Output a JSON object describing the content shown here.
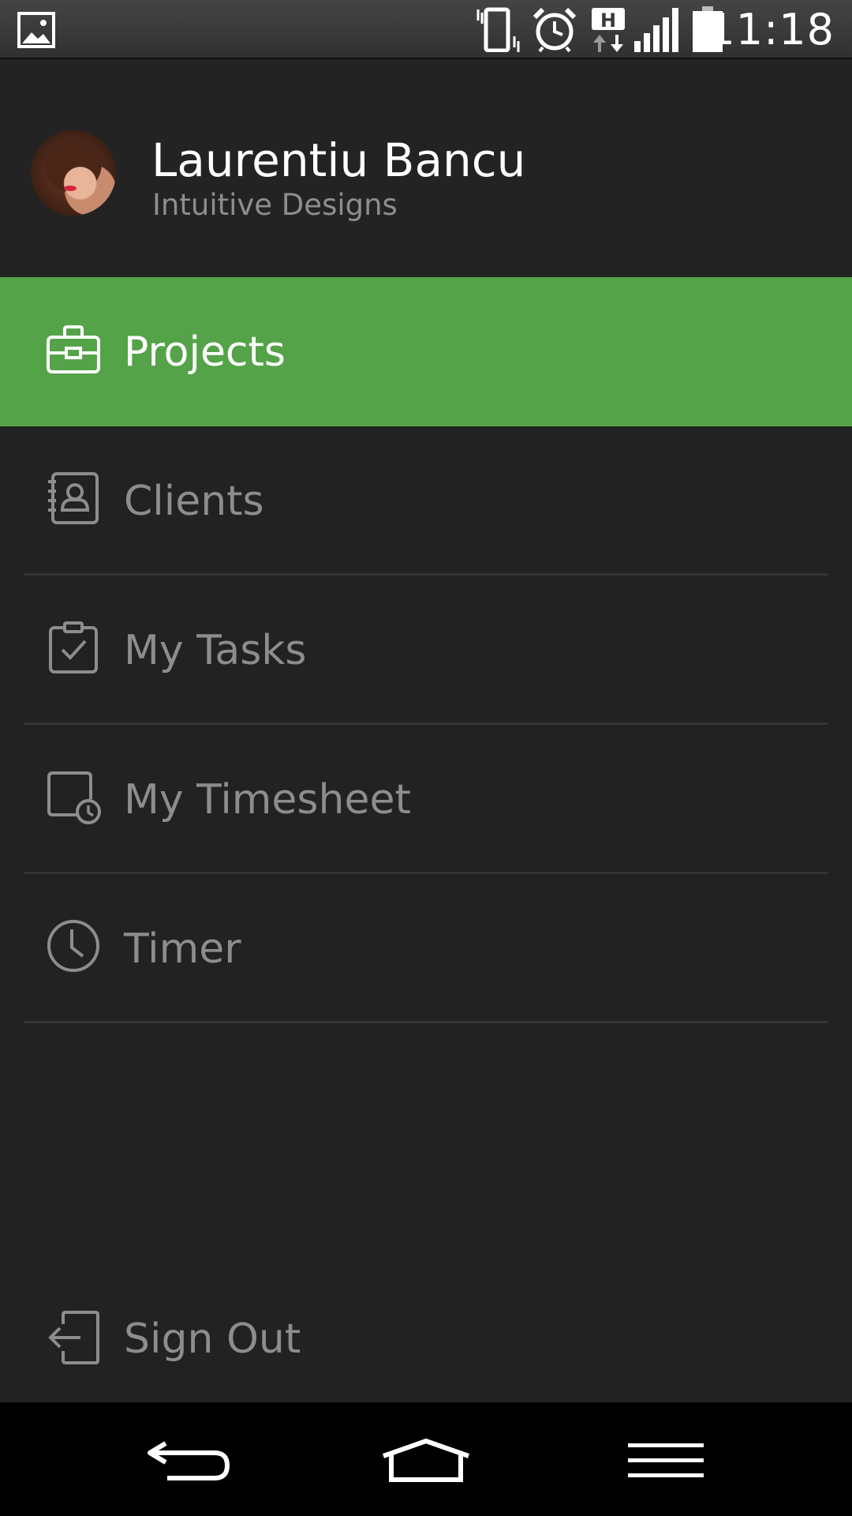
{
  "status_bar": {
    "time": "11:18",
    "icons": [
      "image-notification-icon",
      "vibrate-icon",
      "alarm-icon",
      "hspa-data-icon",
      "signal-icon",
      "battery-icon"
    ]
  },
  "profile": {
    "name": "Laurentiu Bancu",
    "organization": "Intuitive Designs"
  },
  "menu": {
    "items": [
      {
        "label": "Projects",
        "icon": "briefcase-icon",
        "active": true
      },
      {
        "label": "Clients",
        "icon": "contacts-book-icon",
        "active": false
      },
      {
        "label": "My Tasks",
        "icon": "clipboard-check-icon",
        "active": false
      },
      {
        "label": "My Timesheet",
        "icon": "timesheet-clock-icon",
        "active": false
      },
      {
        "label": "Timer",
        "icon": "clock-icon",
        "active": false
      }
    ],
    "sign_out": {
      "label": "Sign Out",
      "icon": "sign-out-icon"
    }
  },
  "colors": {
    "accent": "#55a349",
    "background": "#222222",
    "text_muted": "#8d8d8d"
  },
  "nav_bar": {
    "buttons": [
      "back-icon",
      "home-icon",
      "menu-icon"
    ]
  }
}
